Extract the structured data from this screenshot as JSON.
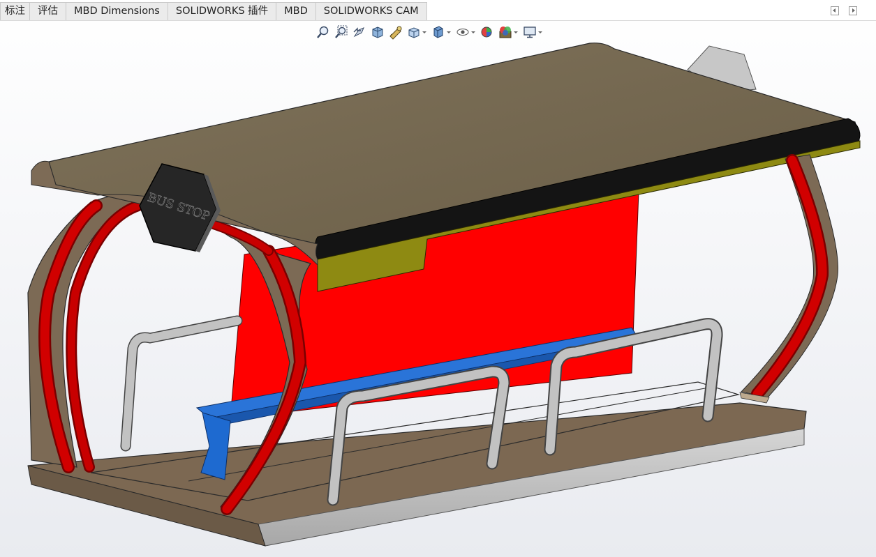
{
  "tabs": [
    {
      "label": "标注"
    },
    {
      "label": "评估"
    },
    {
      "label": "MBD Dimensions"
    },
    {
      "label": "SOLIDWORKS 插件"
    },
    {
      "label": "MBD"
    },
    {
      "label": "SOLIDWORKS CAM"
    }
  ],
  "model": {
    "sign_text": "BUS STOP"
  },
  "colors": {
    "roof_top": "#7a6c54",
    "roof_edge": "#141414",
    "fascia": "#8e8a12",
    "back_panel": "#ff0000",
    "frame_red": "#c40000",
    "bench": "#1f66cc",
    "rail": "#b9b9b9",
    "base": "#7a6650",
    "base_edge": "#c8c8c8",
    "sign": "#2a2a2a"
  },
  "toolbar_icons": [
    "zoom-to-fit-icon",
    "zoom-to-area-icon",
    "previous-view-icon",
    "section-view-icon",
    "dynamic-annotation-icon",
    "view-orientation-icon",
    "display-style-icon",
    "hide-show-items-icon",
    "edit-appearance-icon",
    "apply-scene-icon",
    "view-settings-icon"
  ]
}
